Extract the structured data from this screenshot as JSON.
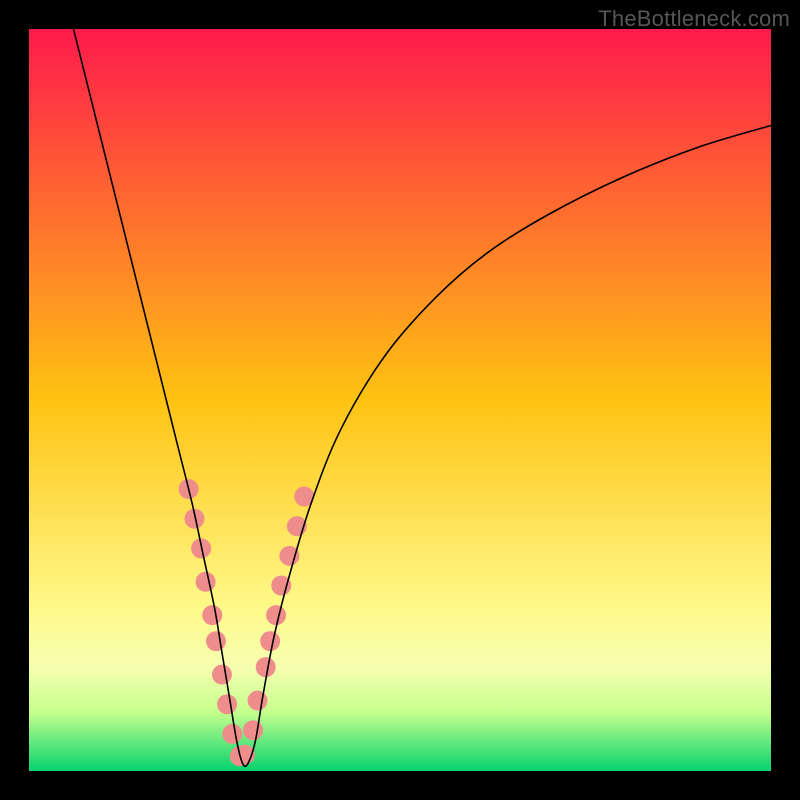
{
  "watermark": "TheBottleneck.com",
  "chart_data": {
    "type": "line",
    "title": "",
    "xlabel": "",
    "ylabel": "",
    "xlim": [
      0,
      100
    ],
    "ylim": [
      0,
      100
    ],
    "legend": false,
    "grid": false,
    "background_gradient": {
      "stops": [
        {
          "offset": 0.0,
          "color": "#ff1a4b"
        },
        {
          "offset": 0.5,
          "color": "#ffc312"
        },
        {
          "offset": 0.78,
          "color": "#fff98a"
        },
        {
          "offset": 0.86,
          "color": "#f6ffb0"
        },
        {
          "offset": 0.92,
          "color": "#c6ff8e"
        },
        {
          "offset": 1.0,
          "color": "#05d36e"
        }
      ]
    },
    "series": [
      {
        "name": "bottleneck-curve",
        "stroke": "#000000",
        "stroke_width": 1.6,
        "x": [
          6,
          8,
          10,
          12,
          14,
          16,
          18,
          20,
          22,
          23.5,
          25,
          26,
          27,
          28,
          28.8,
          29.5,
          30.5,
          31.5,
          33,
          35,
          38,
          42,
          48,
          55,
          62,
          70,
          80,
          90,
          100
        ],
        "y": [
          100,
          92,
          84,
          76,
          68,
          60,
          52,
          44,
          36,
          29,
          22,
          16,
          10,
          4,
          1,
          1,
          4,
          10,
          18,
          26,
          36,
          46,
          56,
          64,
          70,
          75,
          80,
          84,
          87
        ]
      }
    ],
    "scatter": {
      "name": "highlight-points",
      "color": "#ef8d8d",
      "radius": 10,
      "x": [
        21.5,
        22.3,
        23.2,
        23.8,
        24.7,
        25.2,
        26.0,
        26.7,
        27.4,
        28.4,
        29.1,
        30.2,
        30.8,
        31.9,
        32.5,
        33.3,
        34.0,
        35.1,
        36.1,
        37.1
      ],
      "y": [
        38,
        34,
        30,
        25.5,
        21,
        17.5,
        13,
        9,
        5,
        2,
        2.2,
        5.5,
        9.5,
        14,
        17.5,
        21,
        25,
        29,
        33,
        37
      ]
    }
  }
}
